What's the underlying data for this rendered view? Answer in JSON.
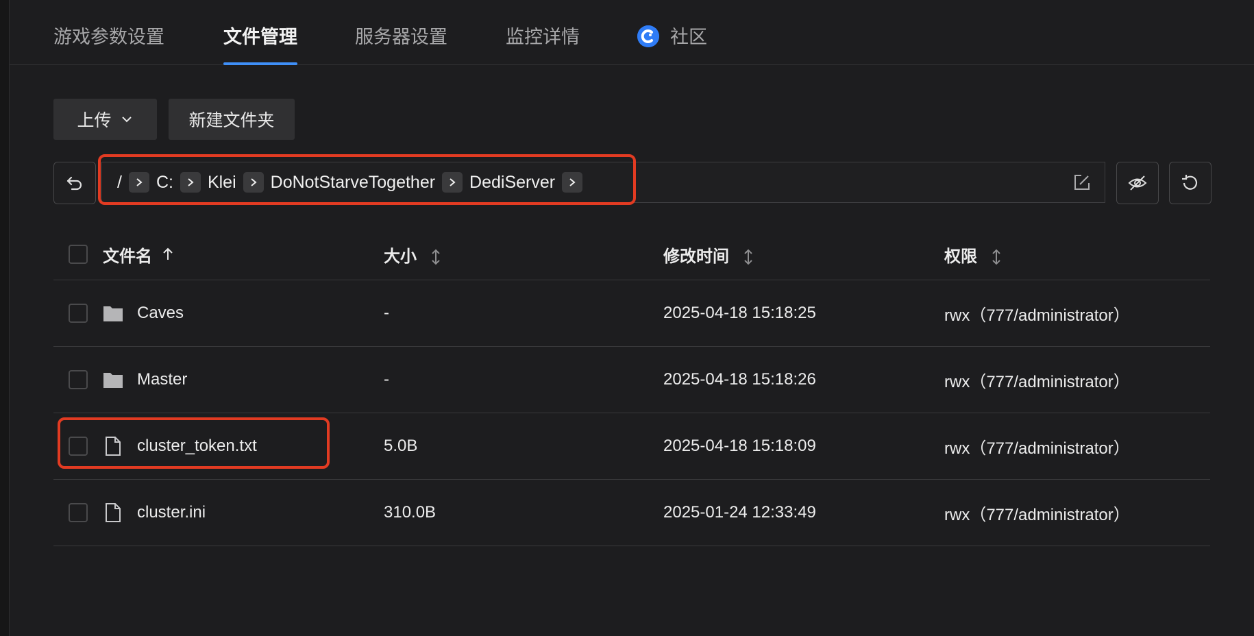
{
  "tabs": [
    {
      "label": "游戏参数设置",
      "active": false
    },
    {
      "label": "文件管理",
      "active": true
    },
    {
      "label": "服务器设置",
      "active": false
    },
    {
      "label": "监控详情",
      "active": false
    },
    {
      "label": "社区",
      "active": false,
      "icon": "community-logo-icon"
    }
  ],
  "toolbar": {
    "upload_label": "上传",
    "new_folder_label": "新建文件夹"
  },
  "path": {
    "root": "/",
    "segments": [
      "C:",
      "Klei",
      "DoNotStarveTogether",
      "DediServer"
    ]
  },
  "table": {
    "columns": [
      "文件名",
      "大小",
      "修改时间",
      "权限"
    ],
    "rows": [
      {
        "type": "folder",
        "name": "Caves",
        "size": "-",
        "modified": "2025-04-18 15:18:25",
        "perm": "rwx（777/administrator）"
      },
      {
        "type": "folder",
        "name": "Master",
        "size": "-",
        "modified": "2025-04-18 15:18:26",
        "perm": "rwx（777/administrator）"
      },
      {
        "type": "file",
        "name": "cluster_token.txt",
        "size": "5.0B",
        "modified": "2025-04-18 15:18:09",
        "perm": "rwx（777/administrator）"
      },
      {
        "type": "file",
        "name": "cluster.ini",
        "size": "310.0B",
        "modified": "2025-01-24 12:33:49",
        "perm": "rwx（777/administrator）"
      }
    ]
  },
  "colors": {
    "accent": "#3f8ff7",
    "highlight": "#e23b22",
    "background": "#1d1d1f"
  }
}
